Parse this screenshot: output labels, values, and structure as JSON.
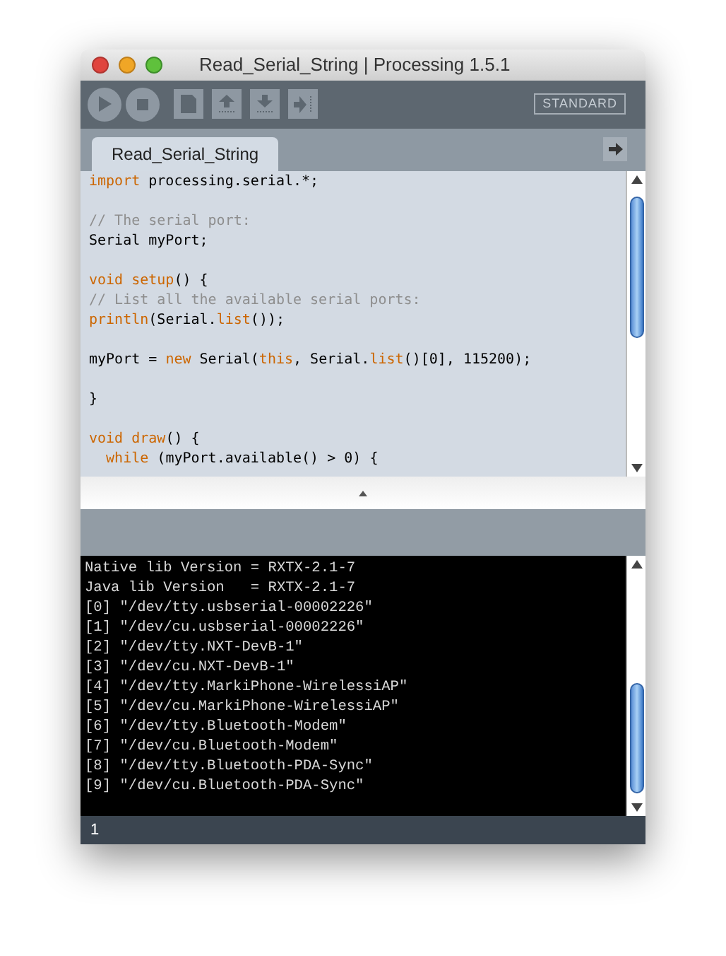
{
  "window": {
    "title": "Read_Serial_String | Processing 1.5.1"
  },
  "toolbar": {
    "mode_button": "STANDARD"
  },
  "tabs": [
    {
      "label": "Read_Serial_String",
      "selected": true
    }
  ],
  "editor": {
    "lines": [
      {
        "kind": "code",
        "segments": [
          {
            "kind": "keyword",
            "text": "import"
          },
          {
            "kind": "plain",
            "text": " processing.serial.*;"
          }
        ]
      },
      {
        "kind": "blank"
      },
      {
        "kind": "code",
        "segments": [
          {
            "kind": "comment",
            "text": "// The serial port:"
          }
        ]
      },
      {
        "kind": "code",
        "segments": [
          {
            "kind": "plain",
            "text": "Serial myPort;"
          }
        ]
      },
      {
        "kind": "blank"
      },
      {
        "kind": "code",
        "segments": [
          {
            "kind": "keyword",
            "text": "void setup"
          },
          {
            "kind": "plain",
            "text": "() {"
          }
        ]
      },
      {
        "kind": "code",
        "segments": [
          {
            "kind": "comment",
            "text": "// List all the available serial ports:"
          }
        ]
      },
      {
        "kind": "code",
        "segments": [
          {
            "kind": "keyword",
            "text": "println"
          },
          {
            "kind": "plain",
            "text": "(Serial."
          },
          {
            "kind": "keyword",
            "text": "list"
          },
          {
            "kind": "plain",
            "text": "());"
          }
        ]
      },
      {
        "kind": "blank"
      },
      {
        "kind": "code",
        "segments": [
          {
            "kind": "plain",
            "text": "myPort = "
          },
          {
            "kind": "keyword",
            "text": "new"
          },
          {
            "kind": "plain",
            "text": " Serial("
          },
          {
            "kind": "keyword",
            "text": "this"
          },
          {
            "kind": "plain",
            "text": ", Serial."
          },
          {
            "kind": "keyword",
            "text": "list"
          },
          {
            "kind": "plain",
            "text": "()[0], 115200);"
          }
        ]
      },
      {
        "kind": "blank"
      },
      {
        "kind": "code",
        "segments": [
          {
            "kind": "plain",
            "text": "}"
          }
        ]
      },
      {
        "kind": "blank"
      },
      {
        "kind": "code",
        "segments": [
          {
            "kind": "keyword",
            "text": "void draw"
          },
          {
            "kind": "plain",
            "text": "() {"
          }
        ]
      },
      {
        "kind": "code",
        "segments": [
          {
            "kind": "keyword",
            "text": "  while"
          },
          {
            "kind": "plain",
            "text": " (myPort.available() > 0) {"
          }
        ]
      }
    ]
  },
  "console": {
    "lines": [
      "Native lib Version = RXTX-2.1-7",
      "Java lib Version   = RXTX-2.1-7",
      "[0] \"/dev/tty.usbserial-00002226\"",
      "[1] \"/dev/cu.usbserial-00002226\"",
      "[2] \"/dev/tty.NXT-DevB-1\"",
      "[3] \"/dev/cu.NXT-DevB-1\"",
      "[4] \"/dev/tty.MarkiPhone-WirelessiAP\"",
      "[5] \"/dev/cu.MarkiPhone-WirelessiAP\"",
      "[6] \"/dev/tty.Bluetooth-Modem\"",
      "[7] \"/dev/cu.Bluetooth-Modem\"",
      "[8] \"/dev/tty.Bluetooth-PDA-Sync\"",
      "[9] \"/dev/cu.Bluetooth-PDA-Sync\""
    ]
  },
  "status_bar": {
    "line_number": "1"
  }
}
